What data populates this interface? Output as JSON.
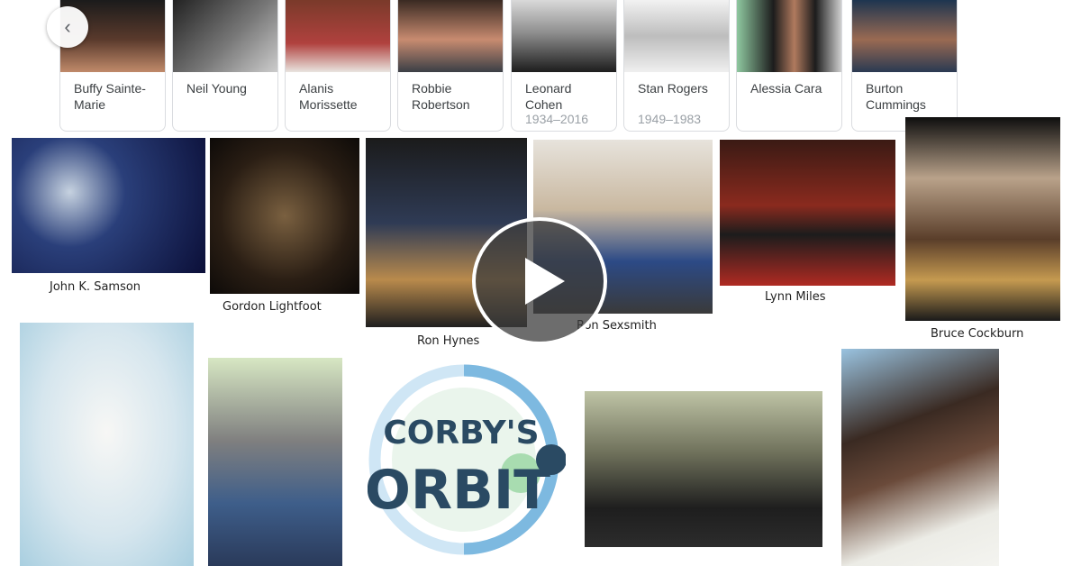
{
  "carousel": {
    "prev_icon": "chevron-left-icon",
    "cards": [
      {
        "name": "Buffy Sainte-Marie",
        "years": ""
      },
      {
        "name": "Neil Young",
        "years": ""
      },
      {
        "name": "Alanis Morissette",
        "years": ""
      },
      {
        "name": "Robbie Robertson",
        "years": ""
      },
      {
        "name": "Leonard Cohen",
        "years": "1934–2016"
      },
      {
        "name": "Stan Rogers",
        "years": "1949–1983"
      },
      {
        "name": "Alessia Cara",
        "years": ""
      },
      {
        "name": "Burton Cummings",
        "years": ""
      }
    ]
  },
  "collage": {
    "captions": {
      "samson": "John K. Samson",
      "lightfoot": "Gordon Lightfoot",
      "hynes": "Ron Hynes",
      "sexsmith": "Ron Sexsmith",
      "miles": "Lynn Miles",
      "cockburn": "Bruce Cockburn"
    },
    "logo": {
      "line1": "CORBY'S",
      "line2": "ORBIT"
    },
    "play_icon": "play-icon"
  },
  "colors": {
    "logo_blue": "#2a4a63",
    "logo_ring": "#7db9e0"
  }
}
